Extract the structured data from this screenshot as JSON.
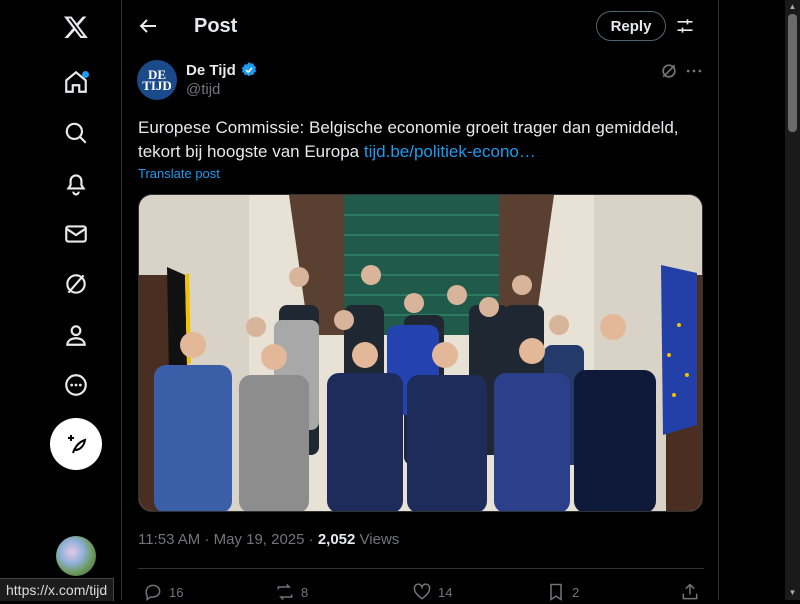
{
  "nav": {
    "logo": "x-logo-icon"
  },
  "header": {
    "title": "Post",
    "reply_label": "Reply"
  },
  "post": {
    "author_name": "De Tijd",
    "author_handle": "@tijd",
    "avatar_text": "DE TIJD",
    "text": "Europese Commissie: Belgische economie groeit trager dan gemiddeld, tekort bij hoogste van Europa ",
    "link": "tijd.be/politiek-econo…",
    "translate_label": "Translate post",
    "time": "11:53 AM · May 19, 2025 · ",
    "views_count": "2,052",
    "views_label": " Views",
    "replies": "16",
    "reposts": "8",
    "likes": "14",
    "bookmarks": "2"
  },
  "status_url": "https://x.com/tijd",
  "colors": {
    "accent": "#1d9bf0",
    "muted": "#71767b",
    "text": "#e7e9ea",
    "background": "#000000"
  }
}
